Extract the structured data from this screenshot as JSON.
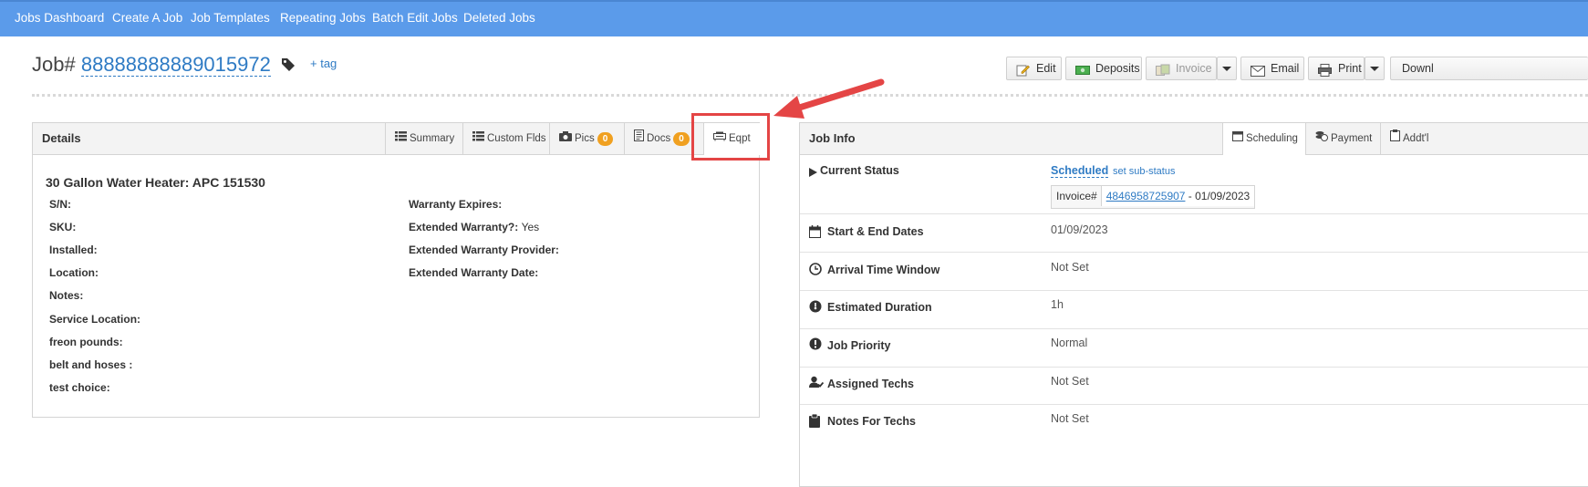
{
  "nav": {
    "items": [
      {
        "label": "Jobs Dashboard"
      },
      {
        "label": "Create A Job"
      },
      {
        "label": "Job Templates"
      },
      {
        "label": "Repeating Jobs"
      },
      {
        "label": "Batch Edit Jobs"
      },
      {
        "label": "Deleted Jobs"
      }
    ]
  },
  "header": {
    "job_prefix": "Job#",
    "job_number": "88888888889015972",
    "add_tag": "+ tag"
  },
  "toolbar": {
    "edit": "Edit",
    "deposits": "Deposits",
    "invoice": "Invoice",
    "email": "Email",
    "print": "Print",
    "download": "Downl"
  },
  "details": {
    "title": "Details",
    "tabs": {
      "summary": "Summary",
      "custom_flds": "Custom Flds",
      "pics": "Pics",
      "pics_count": "0",
      "docs": "Docs",
      "docs_count": "0",
      "eqpt": "Eqpt"
    },
    "equipment": {
      "title": "30 Gallon Water Heater: APC 151530",
      "left_fields": [
        {
          "label": "S/N:"
        },
        {
          "label": "SKU:"
        },
        {
          "label": "Installed:"
        },
        {
          "label": "Location:"
        },
        {
          "label": "Notes:"
        },
        {
          "label": "Service Location:"
        },
        {
          "label": "freon pounds:"
        },
        {
          "label": "belt and hoses :"
        },
        {
          "label": "test choice:"
        }
      ],
      "right_fields": [
        {
          "label": "Warranty Expires:",
          "value": ""
        },
        {
          "label": "Extended Warranty?:",
          "value": "Yes"
        },
        {
          "label": "Extended Warranty Provider:",
          "value": ""
        },
        {
          "label": "Extended Warranty Date:",
          "value": ""
        }
      ]
    }
  },
  "job_info": {
    "title": "Job Info",
    "tabs": {
      "scheduling": "Scheduling",
      "payment": "Payment",
      "addtl": "Addt'l"
    },
    "current_status": {
      "label": "Current Status",
      "value": "Scheduled",
      "sub_status": "set sub-status",
      "invoice_label": "Invoice#",
      "invoice_number": "4846958725907",
      "invoice_date": " - 01/09/2023"
    },
    "rows": [
      {
        "label": "Start & End Dates",
        "value": "01/09/2023",
        "icon": "calendar-icon"
      },
      {
        "label": "Arrival Time Window",
        "value": "Not Set",
        "icon": "clock-icon"
      },
      {
        "label": "Estimated Duration",
        "value": "1h",
        "icon": "duration-icon"
      },
      {
        "label": "Job Priority",
        "value": "Normal",
        "icon": "priority-icon"
      },
      {
        "label": "Assigned Techs",
        "value": "Not Set",
        "icon": "techs-icon"
      },
      {
        "label": "Notes For Techs",
        "value": "Not Set",
        "icon": "clipboard-icon"
      }
    ]
  },
  "colors": {
    "nav_bg": "#5b9bea",
    "link": "#2f7bc4",
    "badge": "#f0a020",
    "annotation": "#e44545"
  }
}
